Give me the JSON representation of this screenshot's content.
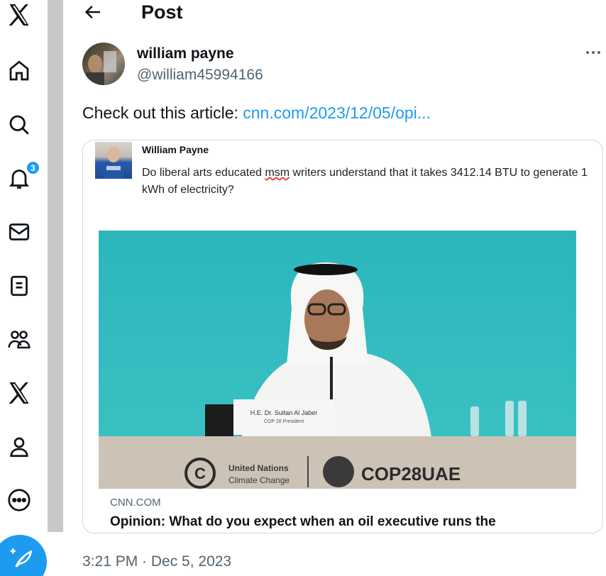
{
  "nav": {
    "items": [
      {
        "icon": "x-logo-icon"
      },
      {
        "icon": "home-icon"
      },
      {
        "icon": "search-icon"
      },
      {
        "icon": "bell-icon",
        "badge": "3"
      },
      {
        "icon": "mail-icon"
      },
      {
        "icon": "lists-icon"
      },
      {
        "icon": "communities-icon"
      },
      {
        "icon": "premium-x-icon"
      },
      {
        "icon": "profile-icon"
      },
      {
        "icon": "more-circle-icon"
      }
    ],
    "post_fab_icon": "feather-plus-icon"
  },
  "header": {
    "title": "Post",
    "back_icon": "arrow-left-icon"
  },
  "post": {
    "author_name": "william payne",
    "author_handle": "@william45994166",
    "text_prefix": "Check out this article: ",
    "link_text": "cnn.com/2023/12/05/opi...",
    "timestamp": "3:21 PM · Dec 5, 2023"
  },
  "card": {
    "screenshot_name": "William Payne",
    "screenshot_text_1": "Do liberal arts educated ",
    "screenshot_text_squiggle": "msm",
    "screenshot_text_2": " writers  understand that it takes 3412.14 BTU to generate 1 kWh of electricity?",
    "photo": {
      "nameplate_line1": "H.E. Dr. Sultan Al Jaber",
      "nameplate_line2": "COP 28 President",
      "un_line1": "United Nations",
      "un_line2": "Climate Change",
      "cop_text": "COP28UAE"
    },
    "domain": "CNN.COM",
    "title": "Opinion: What do you expect when an oil executive runs the"
  },
  "colors": {
    "accent": "#1d9bf0",
    "secondary_text": "#536471",
    "border": "#cfd9de"
  }
}
